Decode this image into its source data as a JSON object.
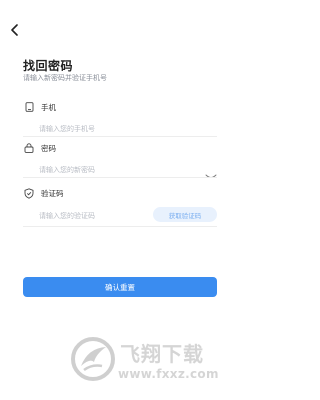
{
  "header": {
    "back_icon": "chevron-left-icon"
  },
  "page": {
    "title": "找回密码",
    "subtitle": "请输入新密码并验证手机号"
  },
  "form": {
    "phone": {
      "label": "手机",
      "placeholder": "请输入您的手机号",
      "value": "",
      "icon": "phone-icon"
    },
    "password": {
      "label": "密码",
      "placeholder": "请输入您的新密码",
      "value": "",
      "icon": "lock-icon",
      "toggle_icon": "eye-closed-icon"
    },
    "code": {
      "label": "验证码",
      "placeholder": "请输入您的验证码",
      "value": "",
      "icon": "shield-icon",
      "get_code_label": "获取验证码"
    }
  },
  "submit_label": "确认重置",
  "watermark": {
    "name": "飞翔下载",
    "url": "www.fxxz.com"
  },
  "colors": {
    "accent": "#3a8cf0",
    "code_button_bg": "#e8f1fd",
    "code_button_text": "#7aaef0"
  }
}
